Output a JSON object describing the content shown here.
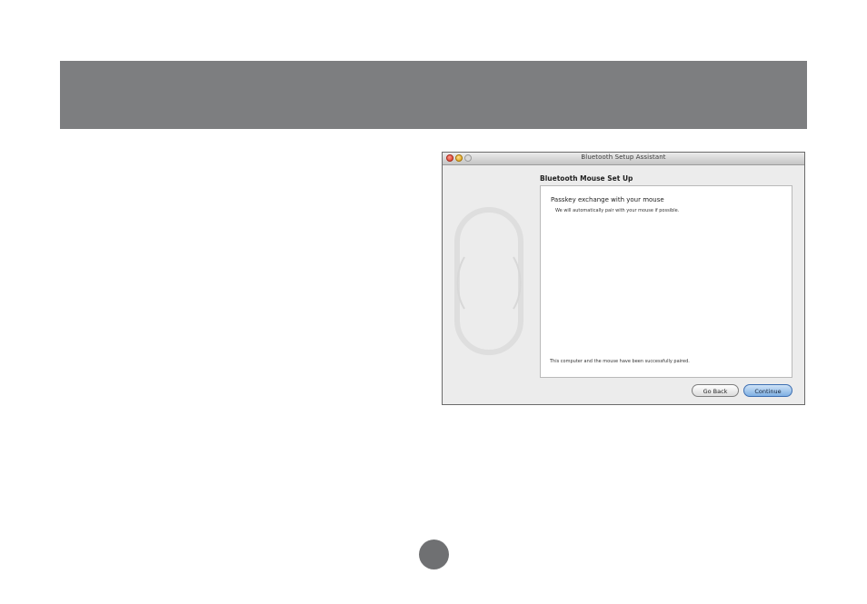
{
  "window": {
    "title": "Bluetooth Setup Assistant"
  },
  "setup": {
    "section_title": "Bluetooth Mouse Set Up",
    "heading": "Passkey exchange with your mouse",
    "subtext": "We will automatically pair with your mouse if possible.",
    "status": "This computer and the mouse have been successfully paired."
  },
  "buttons": {
    "back_label": "Go Back",
    "continue_label": "Continue"
  },
  "colors": {
    "header_band": "#7d7e80",
    "page_marker": "#6f7072",
    "default_button": "#7fb0e3"
  }
}
